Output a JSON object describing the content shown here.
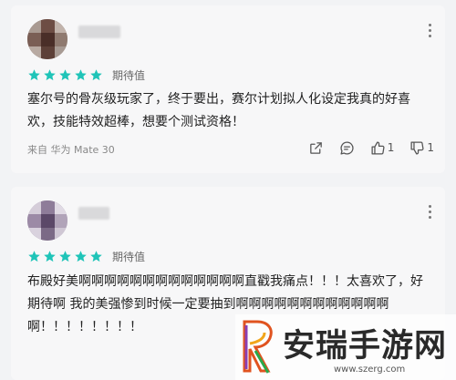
{
  "reviews": [
    {
      "rating": 5,
      "rating_label": "期待值",
      "text": "塞尔号的骨灰级玩家了，终于要出，赛尔计划拟人化设定我真的好喜欢，技能特效超棒，想要个测试资格！",
      "device": "来自 华为 Mate 30",
      "likes": "1",
      "dislikes": "1"
    },
    {
      "rating": 5,
      "rating_label": "期待值",
      "text": "布殿好美啊啊啊啊啊啊啊啊啊啊啊啊啊直戳我痛点！！！太喜欢了，好期待啊 我的美强惨到时候一定要抽到啊啊啊啊啊啊啊啊啊啊啊啊啊！！！！！！！！"
    }
  ],
  "colors": {
    "star": "#1fc4b8",
    "accent": "#2bc1b0"
  },
  "watermark": {
    "text": "安瑞手游网",
    "url": "www.szerg.com"
  }
}
